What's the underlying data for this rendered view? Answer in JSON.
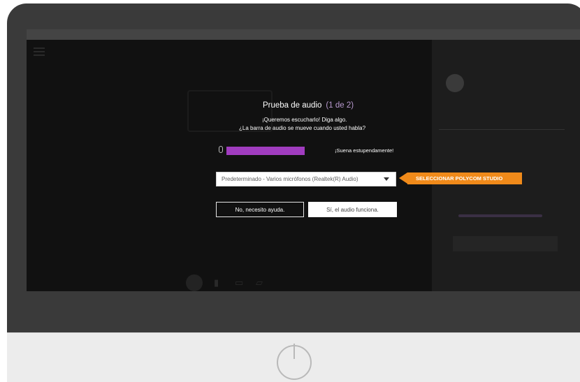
{
  "dialog": {
    "title": "Prueba de audio",
    "step": "(1 de 2)",
    "message_line1": "¡Queremos escucharlo! Diga algo.",
    "message_line2": "¿La barra de audio se mueve cuando usted habla?",
    "mic_level": 0.8,
    "status": "¡Suena estupendamente!",
    "device_select_value": "Predeterminado - Varios micrófonos (Realtek(R) Audio)",
    "no_button": "No, necesito ayuda.",
    "yes_button": "Sí, el audio funciona."
  },
  "callout": {
    "label": "SELECCIONAR POLYCOM STUDIO",
    "color": "#f08a1a"
  },
  "colors": {
    "level_bar": "#a03cbf",
    "step_text": "#b99ad0"
  },
  "icons": [
    "menu-icon",
    "microphone-icon",
    "dropdown-caret-icon",
    "power-icon"
  ]
}
